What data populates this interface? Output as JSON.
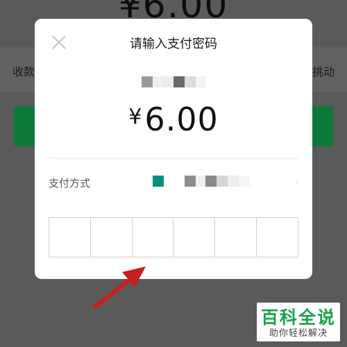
{
  "background": {
    "amount": "¥6.00",
    "left_text": "收款",
    "right_text": "挑动"
  },
  "dialog": {
    "title": "请输入支付密码",
    "currency": "¥",
    "amount": "6.00",
    "payment_method_label": "支付方式",
    "chevron": "›",
    "password_digits": 6
  },
  "watermark": {
    "main": "百科全说",
    "sub": "助你轻松解决"
  },
  "colors": {
    "overlay": "#5a5a5a",
    "accent_green": "#0b7a3a",
    "wechat_teal": "#0a8f7e",
    "arrow_red": "#c8201e",
    "watermark_green": "#1ba24a"
  }
}
